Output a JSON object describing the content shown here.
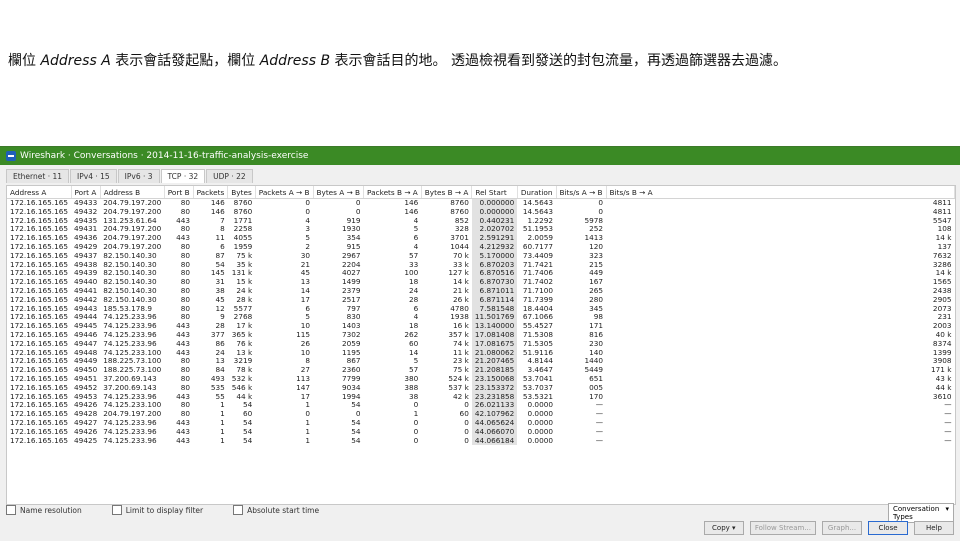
{
  "slide": {
    "p1": "欄位 ",
    "a": "Address A",
    "p2": " 表示會話發起點，欄位 ",
    "b": "Address B",
    "p3": " 表示會話目的地。 透過檢視看到發送的封包流量，再透過篩選器去過濾。"
  },
  "window": {
    "title": "Wireshark · Conversations · 2014-11-16-traffic-analysis-exercise"
  },
  "tabs": [
    "Ethernet · 11",
    "IPv4 · 15",
    "IPv6 · 3",
    "TCP · 32",
    "UDP · 22"
  ],
  "active_tab": 3,
  "columns": [
    "Address A",
    "Port A",
    "Address B",
    "Port B",
    "Packets",
    "Bytes",
    "Packets A → B",
    "Bytes A → B",
    "Packets B → A",
    "Bytes B → A",
    "Rel Start",
    "Duration",
    "Bits/s A → B",
    "Bits/s B → A"
  ],
  "rows": [
    [
      "172.16.165.165",
      "49433",
      "204.79.197.200",
      "80",
      "146",
      "8760",
      "0",
      "0",
      "146",
      "8760",
      "0.000000",
      "14.5643",
      "0",
      "4811"
    ],
    [
      "172.16.165.165",
      "49432",
      "204.79.197.200",
      "80",
      "146",
      "8760",
      "0",
      "0",
      "146",
      "8760",
      "0.000000",
      "14.5643",
      "0",
      "4811"
    ],
    [
      "172.16.165.165",
      "49435",
      "131.253.61.64",
      "443",
      "7",
      "1771",
      "4",
      "919",
      "4",
      "852",
      "0.440231",
      "1.2292",
      "5978",
      "5547"
    ],
    [
      "172.16.165.165",
      "49431",
      "204.79.197.200",
      "80",
      "8",
      "2258",
      "3",
      "1930",
      "5",
      "328",
      "2.020702",
      "51.1953",
      "252",
      "108"
    ],
    [
      "172.16.165.165",
      "49436",
      "204.79.197.200",
      "443",
      "11",
      "4055",
      "5",
      "354",
      "6",
      "3701",
      "2.591291",
      "2.0059",
      "1413",
      "14 k"
    ],
    [
      "172.16.165.165",
      "49429",
      "204.79.197.200",
      "80",
      "6",
      "1959",
      "2",
      "915",
      "4",
      "1044",
      "4.212932",
      "60.7177",
      "120",
      "137"
    ],
    [
      "172.16.165.165",
      "49437",
      "82.150.140.30",
      "80",
      "87",
      "75 k",
      "30",
      "2967",
      "57",
      "70 k",
      "5.170000",
      "73.4409",
      "323",
      "7632"
    ],
    [
      "172.16.165.165",
      "49438",
      "82.150.140.30",
      "80",
      "54",
      "35 k",
      "21",
      "2204",
      "33",
      "33 k",
      "6.870203",
      "71.7421",
      "215",
      "3286"
    ],
    [
      "172.16.165.165",
      "49439",
      "82.150.140.30",
      "80",
      "145",
      "131 k",
      "45",
      "4027",
      "100",
      "127 k",
      "6.870516",
      "71.7406",
      "449",
      "14 k"
    ],
    [
      "172.16.165.165",
      "49440",
      "82.150.140.30",
      "80",
      "31",
      "15 k",
      "13",
      "1499",
      "18",
      "14 k",
      "6.870730",
      "71.7402",
      "167",
      "1565"
    ],
    [
      "172.16.165.165",
      "49441",
      "82.150.140.30",
      "80",
      "38",
      "24 k",
      "14",
      "2379",
      "24",
      "21 k",
      "6.871011",
      "71.7100",
      "265",
      "2438"
    ],
    [
      "172.16.165.165",
      "49442",
      "82.150.140.30",
      "80",
      "45",
      "28 k",
      "17",
      "2517",
      "28",
      "26 k",
      "6.871114",
      "71.7399",
      "280",
      "2905"
    ],
    [
      "172.16.165.165",
      "49443",
      "185.53.178.9",
      "80",
      "12",
      "5577",
      "6",
      "797",
      "6",
      "4780",
      "7.581548",
      "18.4404",
      "345",
      "2073"
    ],
    [
      "172.16.165.165",
      "49444",
      "74.125.233.96",
      "80",
      "9",
      "2768",
      "5",
      "830",
      "4",
      "1938",
      "11.501769",
      "67.1066",
      "98",
      "231"
    ],
    [
      "172.16.165.165",
      "49445",
      "74.125.233.96",
      "443",
      "28",
      "17 k",
      "10",
      "1403",
      "18",
      "16 k",
      "13.140000",
      "55.4527",
      "171",
      "2003"
    ],
    [
      "172.16.165.165",
      "49446",
      "74.125.233.96",
      "443",
      "377",
      "365 k",
      "115",
      "7302",
      "262",
      "357 k",
      "17.081408",
      "71.5308",
      "816",
      "40 k"
    ],
    [
      "172.16.165.165",
      "49447",
      "74.125.233.96",
      "443",
      "86",
      "76 k",
      "26",
      "2059",
      "60",
      "74 k",
      "17.081675",
      "71.5305",
      "230",
      "8374"
    ],
    [
      "172.16.165.165",
      "49448",
      "74.125.233.100",
      "443",
      "24",
      "13 k",
      "10",
      "1195",
      "14",
      "11 k",
      "21.080062",
      "51.9116",
      "140",
      "1399"
    ],
    [
      "172.16.165.165",
      "49449",
      "188.225.73.100",
      "80",
      "13",
      "3219",
      "8",
      "867",
      "5",
      "23 k",
      "21.207465",
      "4.8144",
      "1440",
      "3908"
    ],
    [
      "172.16.165.165",
      "49450",
      "188.225.73.100",
      "80",
      "84",
      "78 k",
      "27",
      "2360",
      "57",
      "75 k",
      "21.208185",
      "3.4647",
      "5449",
      "171 k"
    ],
    [
      "172.16.165.165",
      "49451",
      "37.200.69.143",
      "80",
      "493",
      "532 k",
      "113",
      "7799",
      "380",
      "524 k",
      "23.150068",
      "53.7041",
      "651",
      "43 k"
    ],
    [
      "172.16.165.165",
      "49452",
      "37.200.69.143",
      "80",
      "535",
      "546 k",
      "147",
      "9034",
      "388",
      "537 k",
      "23.153372",
      "53.7037",
      "005",
      "44 k"
    ],
    [
      "172.16.165.165",
      "49453",
      "74.125.233.96",
      "443",
      "55",
      "44 k",
      "17",
      "1994",
      "38",
      "42 k",
      "23.231858",
      "53.5321",
      "170",
      "3610"
    ],
    [
      "172.16.165.165",
      "49426",
      "74.125.233.100",
      "80",
      "1",
      "54",
      "1",
      "54",
      "0",
      "0",
      "26.021133",
      "0.0000",
      "—",
      "—"
    ],
    [
      "172.16.165.165",
      "49428",
      "204.79.197.200",
      "80",
      "1",
      "60",
      "0",
      "0",
      "1",
      "60",
      "42.107962",
      "0.0000",
      "—",
      "—"
    ],
    [
      "172.16.165.165",
      "49427",
      "74.125.233.96",
      "443",
      "1",
      "54",
      "1",
      "54",
      "0",
      "0",
      "44.065624",
      "0.0000",
      "—",
      "—"
    ],
    [
      "172.16.165.165",
      "49426",
      "74.125.233.96",
      "443",
      "1",
      "54",
      "1",
      "54",
      "0",
      "0",
      "44.066070",
      "0.0000",
      "—",
      "—"
    ],
    [
      "172.16.165.165",
      "49425",
      "74.125.233.96",
      "443",
      "1",
      "54",
      "1",
      "54",
      "0",
      "0",
      "44.066184",
      "0.0000",
      "—",
      "—"
    ]
  ],
  "highlight_col": 10,
  "checkboxes": [
    "Name resolution",
    "Limit to display filter",
    "Absolute start time"
  ],
  "conv_type": "Conversation Types",
  "buttons": {
    "copy": "Copy",
    "follow": "Follow Stream...",
    "graph": "Graph...",
    "close": "Close",
    "help": "Help"
  }
}
